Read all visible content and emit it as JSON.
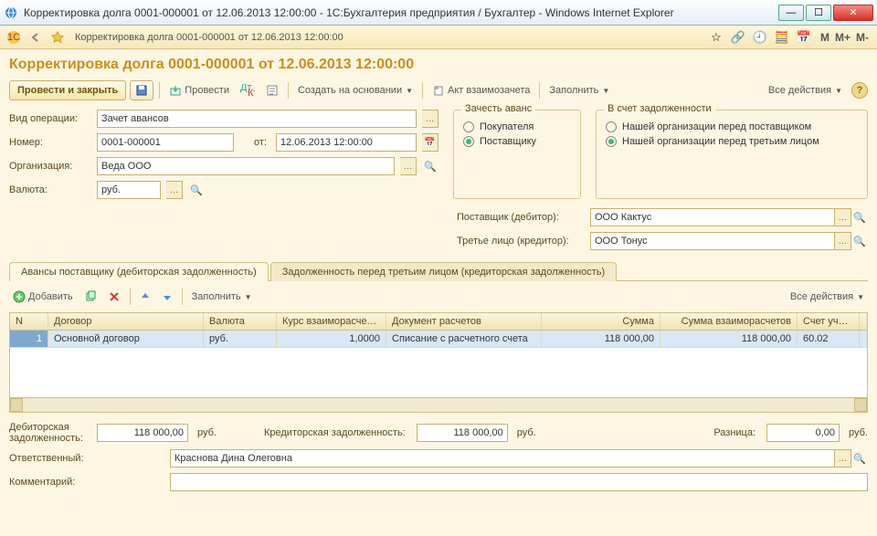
{
  "window": {
    "title": "Корректировка долга 0001-000001 от 12.06.2013 12:00:00 - 1С:Бухгалтерия предприятия / Бухгалтер - Windows Internet Explorer"
  },
  "tab_title": "Корректировка долга 0001-000001 от 12.06.2013 12:00:00",
  "doc_title": "Корректировка долга 0001-000001 от 12.06.2013 12:00:00",
  "cmdbar": {
    "post_close": "Провести и закрыть",
    "post": "Провести",
    "create_based": "Создать на основании",
    "offset_act": "Акт взаимозачета",
    "fill": "Заполнить",
    "all_actions": "Все действия"
  },
  "form": {
    "op_type_label": "Вид операции:",
    "op_type": "Зачет авансов",
    "number_label": "Номер:",
    "number": "0001-000001",
    "from_label": "от:",
    "date": "12.06.2013 12:00:00",
    "org_label": "Организация:",
    "org": "Веда ООО",
    "currency_label": "Валюта:",
    "currency": "руб."
  },
  "group1": {
    "legend": "Зачесть аванс",
    "opt1": "Покупателя",
    "opt2": "Поставщику"
  },
  "group2": {
    "legend": "В счет задолженности",
    "opt1": "Нашей организации перед поставщиком",
    "opt2": "Нашей организации перед третьим лицом"
  },
  "supplier": {
    "label1": "Поставщик (дебитор):",
    "val1": "ООО Кактус",
    "label2": "Третье лицо (кредитор):",
    "val2": "ООО Тонус"
  },
  "tabs": {
    "t1": "Авансы поставщику (дебиторская задолженность)",
    "t2": "Задолженность перед третьим лицом (кредиторская задолженность)"
  },
  "tabbar": {
    "add": "Добавить",
    "fill": "Заполнить",
    "all_actions": "Все действия"
  },
  "table": {
    "headers": {
      "n": "N",
      "contract": "Договор",
      "currency": "Валюта",
      "rate": "Курс взаиморасчетов",
      "doc": "Документ расчетов",
      "sum": "Сумма",
      "sum_settl": "Сумма взаиморасчетов",
      "account": "Счет учета"
    },
    "rows": [
      {
        "n": "1",
        "contract": "Основной договор",
        "currency": "руб.",
        "rate": "1,0000",
        "doc": "Списание с расчетного счета",
        "sum": "118 000,00",
        "sum_settl": "118 000,00",
        "account": "60.02"
      }
    ]
  },
  "footer": {
    "deb_label": "Дебиторская задолженность:",
    "deb": "118 000,00",
    "unit": "руб.",
    "cred_label": "Кредиторская задолженность:",
    "cred": "118 000,00",
    "diff_label": "Разница:",
    "diff": "0,00",
    "resp_label": "Ответственный:",
    "resp": "Краснова Дина Олеговна",
    "comment_label": "Комментарий:",
    "comment": ""
  }
}
